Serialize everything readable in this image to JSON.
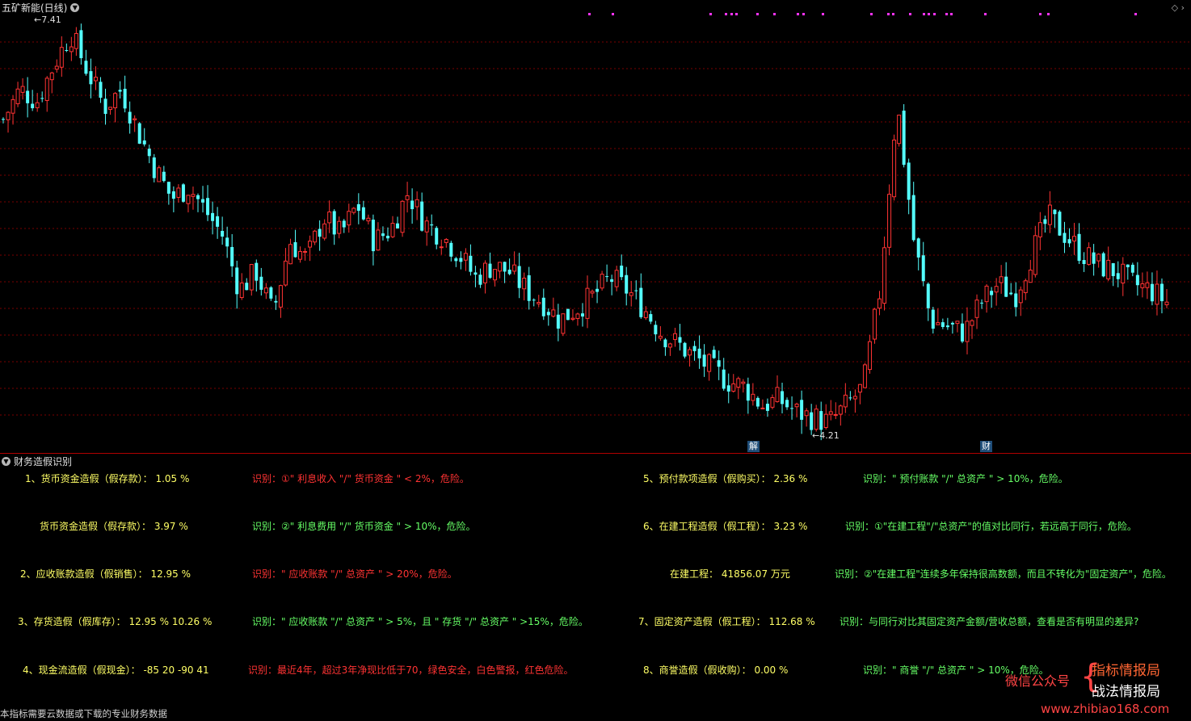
{
  "header": {
    "title": "五矿新能(日线)",
    "high_marker": "7.41",
    "low_marker": "4.21",
    "tags": [
      "解",
      "财"
    ]
  },
  "colors": {
    "up": "#ff3333",
    "down": "#54ffff",
    "gridline": "#7a0000",
    "event_dot": "#ff33ff",
    "divider": "#b00000"
  },
  "chart_data": {
    "type": "candlestick",
    "title": "五矿新能(日线)",
    "ylim": [
      4.1,
      7.55
    ],
    "annotations": [
      "7.41",
      "4.21"
    ],
    "price_path": [
      6.7,
      6.95,
      6.85,
      7.15,
      7.41,
      7.1,
      6.8,
      6.95,
      6.6,
      6.3,
      6.05,
      6.15,
      5.95,
      5.75,
      5.3,
      5.45,
      5.1,
      5.7,
      5.55,
      5.9,
      5.75,
      6.0,
      5.7,
      5.8,
      6.1,
      5.85,
      5.75,
      5.6,
      5.4,
      5.5,
      5.45,
      5.3,
      5.2,
      5.05,
      5.15,
      5.25,
      5.4,
      5.3,
      5.15,
      4.95,
      4.85,
      4.75,
      4.65,
      4.55,
      4.5,
      4.35,
      4.4,
      4.3,
      4.25,
      4.21,
      4.35,
      4.5,
      5.3,
      6.85,
      5.7,
      5.05,
      5.0,
      4.95,
      5.2,
      5.35,
      5.25,
      5.6,
      5.9,
      5.75,
      5.6,
      5.5,
      5.45,
      5.35,
      5.3,
      5.2
    ]
  },
  "indicator": {
    "title": "财务造假识别",
    "left": [
      {
        "label": "1、货币资金造假（假存款）： 1.05 %",
        "note": "识别：①\" 利息收入 \"/\" 货币资金 \" < 2%，危险。",
        "note_color": "red"
      },
      {
        "label": "货币资金造假（假存款）： 3.97 %",
        "note": "识别：②\" 利息费用 \"/\" 货币资金 \" > 10%，危险。",
        "note_color": "green"
      },
      {
        "label": "2、应收账款造假（假销售）： 12.95 %",
        "note": "识别：\" 应收账款 \"/\" 总资产 \" > 20%，危险。",
        "note_color": "red"
      },
      {
        "label": "3、存货造假（假库存）： 12.95 %  10.26 %",
        "note": "识别：\" 应收账款 \"/\" 总资产 \" > 5%，且 \" 存货 \"/\" 总资产 \" >15%，危险。",
        "note_color": "green"
      },
      {
        "label": "4、现金流造假（假现金）： -85  20  -90  41",
        "note": "识别：最近4年，超过3年净现比低于70，绿色安全，白色警报，红色危险。",
        "note_color": "red"
      }
    ],
    "right": [
      {
        "label": "5、预付款项造假（假购买）： 2.36 %",
        "note": "识别：\" 预付账款 \"/\" 总资产 \" > 10%，危险。",
        "note_color": "green"
      },
      {
        "label": "6、在建工程造假（假工程）： 3.23 %",
        "note": "识别：①\"在建工程\"/\"总资产\"的值对比同行，若远高于同行，危险。",
        "note_color": "green"
      },
      {
        "label": "在建工程： 41856.07 万元",
        "note": "识别：②\"在建工程\"连续多年保持很高数额，而且不转化为\"固定资产\"，危险。",
        "note_color": "green"
      },
      {
        "label": "7、固定资产造假（假工程）： 112.68 %",
        "note": "识别：与同行对比其固定资产金额/营收总额，查看是否有明显的差异?",
        "note_color": "green"
      },
      {
        "label": "8、商誉造假（假收购）： 0.00 %",
        "note": "识别：\" 商誉 \"/\" 总资产 \" > 10%，危险。",
        "note_color": "green"
      }
    ]
  },
  "footer": {
    "text": "本指标需要云数据或下载的专业财务数据"
  },
  "watermark": {
    "wechat": "微信公众号",
    "line1": "指标情报局",
    "line2": "战法情报局",
    "url": "www.zhibiao168.com"
  }
}
